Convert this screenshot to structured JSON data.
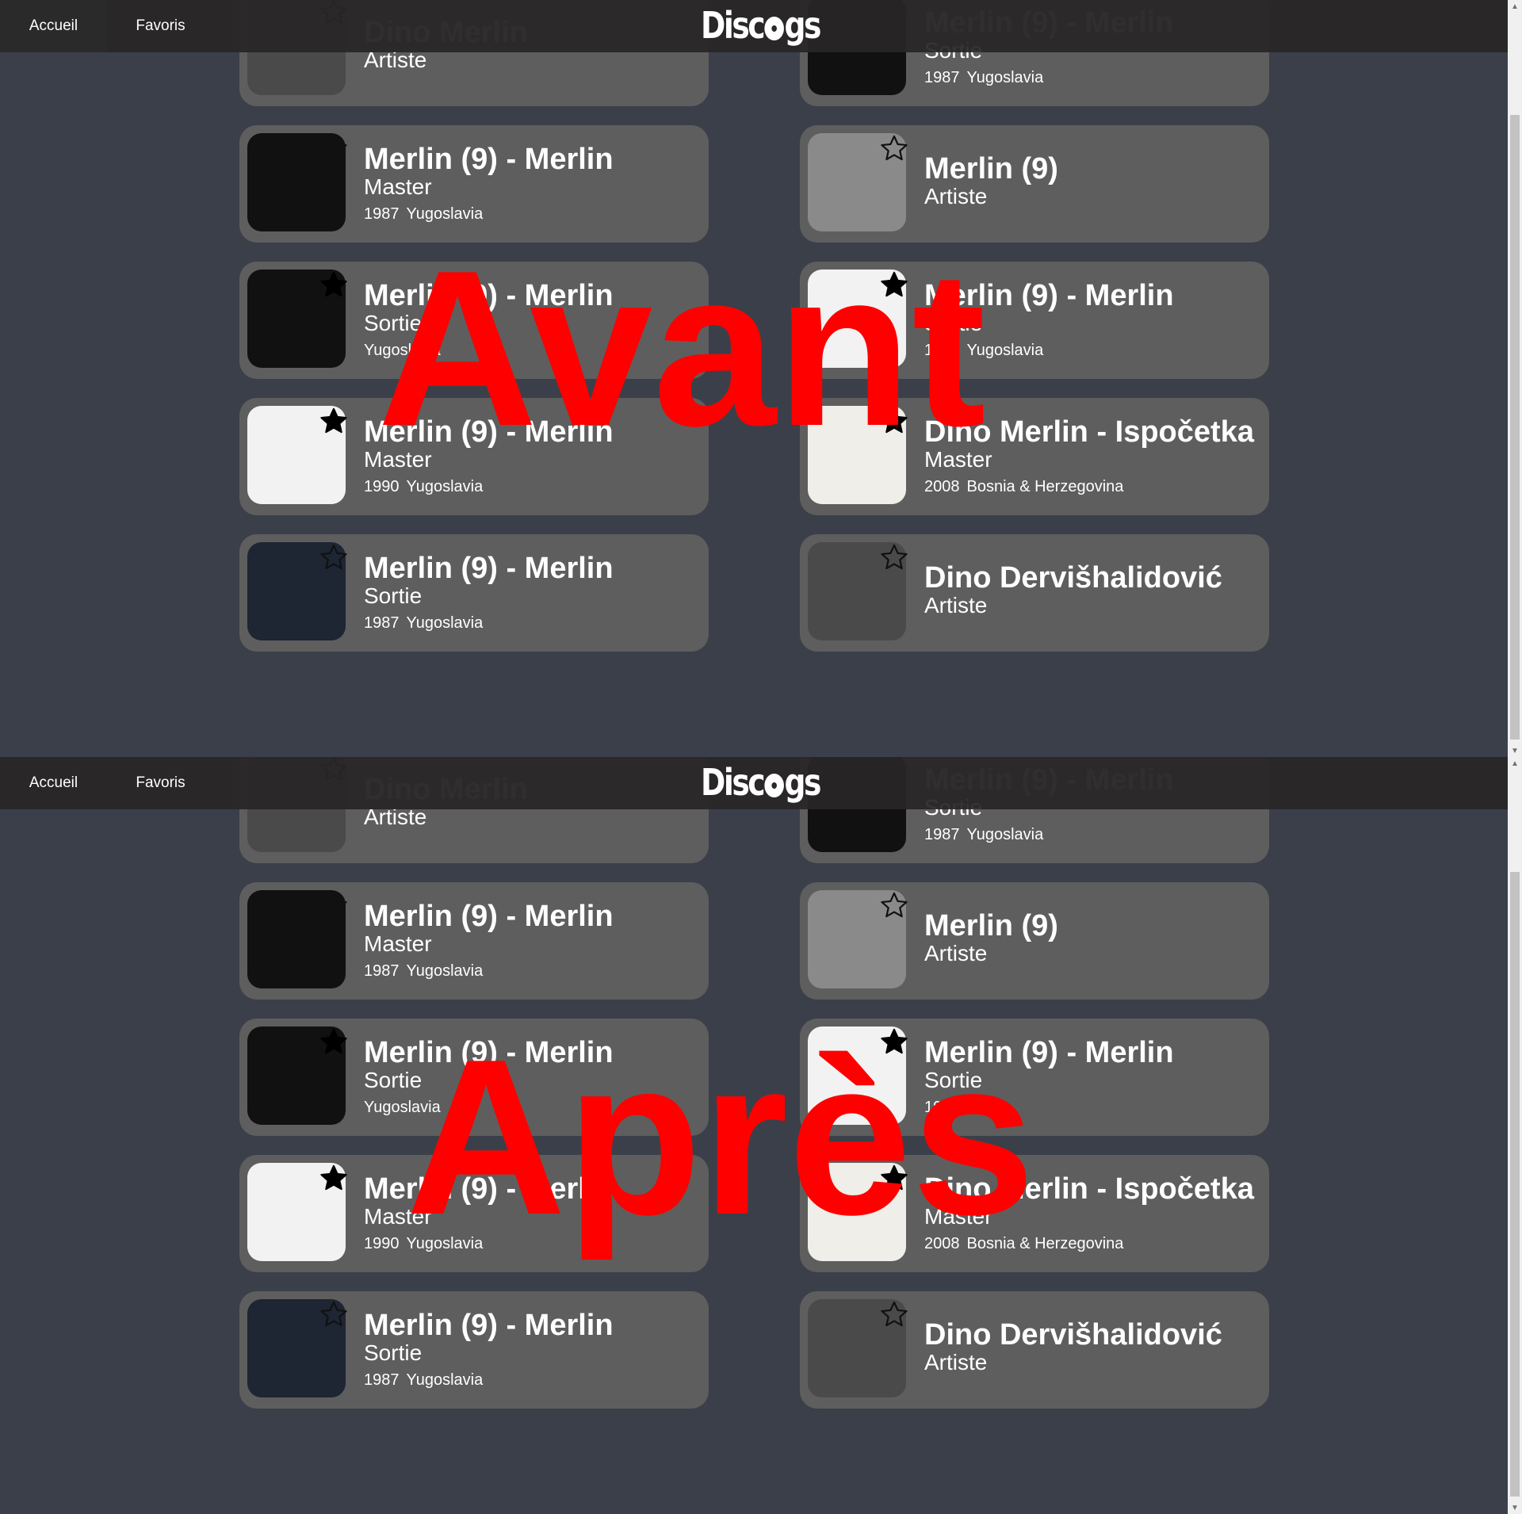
{
  "panels": [
    {
      "label": "Avant",
      "nav": {
        "home_label": "Accueil",
        "favorites_label": "Favoris"
      },
      "logo": "Discogs",
      "cards": [
        {
          "title": "Dino Merlin",
          "type": "Artiste",
          "year": "",
          "country": "",
          "starred": false
        },
        {
          "title": "Merlin (9) - Merlin",
          "type": "Sortie",
          "year": "1987",
          "country": "Yugoslavia",
          "starred": false
        },
        {
          "title": "Merlin (9) - Merlin",
          "type": "Master",
          "year": "1987",
          "country": "Yugoslavia",
          "starred": false
        },
        {
          "title": "Merlin (9)",
          "type": "Artiste",
          "year": "",
          "country": "",
          "starred": false
        },
        {
          "title": "Merlin (9) - Merlin",
          "type": "Sortie",
          "year": "",
          "country": "Yugoslavia",
          "starred": true
        },
        {
          "title": "Merlin (9) - Merlin",
          "type": "Sortie",
          "year": "1990",
          "country": "Yugoslavia",
          "starred": true
        },
        {
          "title": "Merlin (9) - Merlin",
          "type": "Master",
          "year": "1990",
          "country": "Yugoslavia",
          "starred": true
        },
        {
          "title": "Dino Merlin - Ispočetka",
          "type": "Master",
          "year": "2008",
          "country": "Bosnia & Herzegovina",
          "starred": true
        },
        {
          "title": "Merlin (9) - Merlin",
          "type": "Sortie",
          "year": "1987",
          "country": "Yugoslavia",
          "starred": false
        },
        {
          "title": "Dino Dervišhalidović",
          "type": "Artiste",
          "year": "",
          "country": "",
          "starred": false
        }
      ]
    },
    {
      "label": "Après",
      "nav": {
        "home_label": "Accueil",
        "favorites_label": "Favoris"
      },
      "logo": "Discogs",
      "cards": [
        {
          "title": "Dino Merlin",
          "type": "Artiste",
          "year": "",
          "country": "",
          "starred": false
        },
        {
          "title": "Merlin (9) - Merlin",
          "type": "Sortie",
          "year": "1987",
          "country": "Yugoslavia",
          "starred": false
        },
        {
          "title": "Merlin (9) - Merlin",
          "type": "Master",
          "year": "1987",
          "country": "Yugoslavia",
          "starred": false
        },
        {
          "title": "Merlin (9)",
          "type": "Artiste",
          "year": "",
          "country": "",
          "starred": false
        },
        {
          "title": "Merlin (9) - Merlin",
          "type": "Sortie",
          "year": "",
          "country": "Yugoslavia",
          "starred": true
        },
        {
          "title": "Merlin (9) - Merlin",
          "type": "Sortie",
          "year": "1990",
          "country": "",
          "starred": true
        },
        {
          "title": "Merlin (9) - Merlin",
          "type": "Master",
          "year": "1990",
          "country": "Yugoslavia",
          "starred": true
        },
        {
          "title": "Dino Merlin - Ispočetka",
          "type": "Master",
          "year": "2008",
          "country": "Bosnia & Herzegovina",
          "starred": true
        },
        {
          "title": "Merlin (9) - Merlin",
          "type": "Sortie",
          "year": "1987",
          "country": "Yugoslavia",
          "starred": false
        },
        {
          "title": "Dino Dervišhalidović",
          "type": "Artiste",
          "year": "",
          "country": "",
          "starred": false
        }
      ]
    }
  ],
  "colors": {
    "background": "#3b3f49",
    "card": "#5e5e5e",
    "navbar": "#282626",
    "overlay_text": "#ff0000"
  },
  "icons": {
    "favorite_empty": "star-outline-icon",
    "favorite_filled": "star-filled-icon"
  }
}
